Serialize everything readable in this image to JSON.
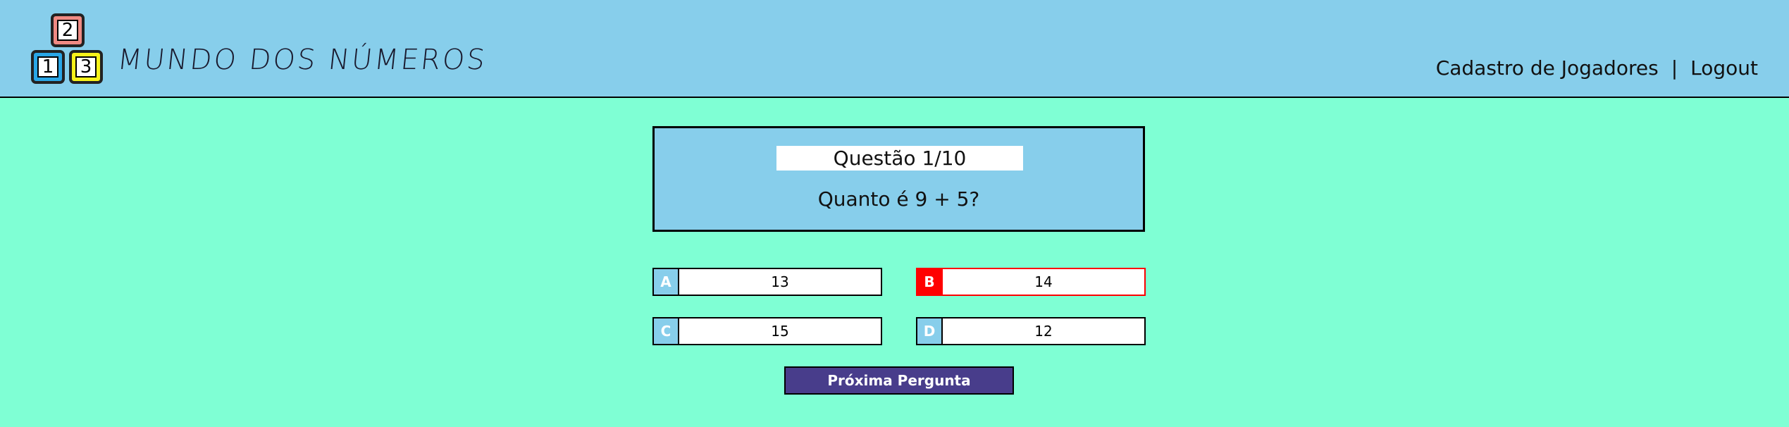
{
  "header": {
    "logo_blocks": [
      "2",
      "1",
      "3"
    ],
    "brand": "MUNDO DOS NÚMEROS",
    "nav": {
      "cadastro": "Cadastro de Jogadores",
      "separator": "|",
      "logout": "Logout"
    }
  },
  "quiz": {
    "question_number": "Questão 1/10",
    "question_text": "Quanto é 9 + 5?",
    "options": [
      {
        "letter": "A",
        "value": "13",
        "state": "default"
      },
      {
        "letter": "B",
        "value": "14",
        "state": "selected-wrong"
      },
      {
        "letter": "C",
        "value": "15",
        "state": "default"
      },
      {
        "letter": "D",
        "value": "12",
        "state": "default"
      }
    ],
    "next_label": "Próxima Pergunta"
  },
  "colors": {
    "page_bg": "#7fffd4",
    "header_bg": "#87ceeb",
    "card_bg": "#87ceeb",
    "option_letter_bg": "#87ceeb",
    "wrong": "#ff0000",
    "next_button_bg": "#483d8b",
    "block_2": "#f08a83",
    "block_1": "#29a6e6",
    "block_3": "#f7f21a"
  }
}
